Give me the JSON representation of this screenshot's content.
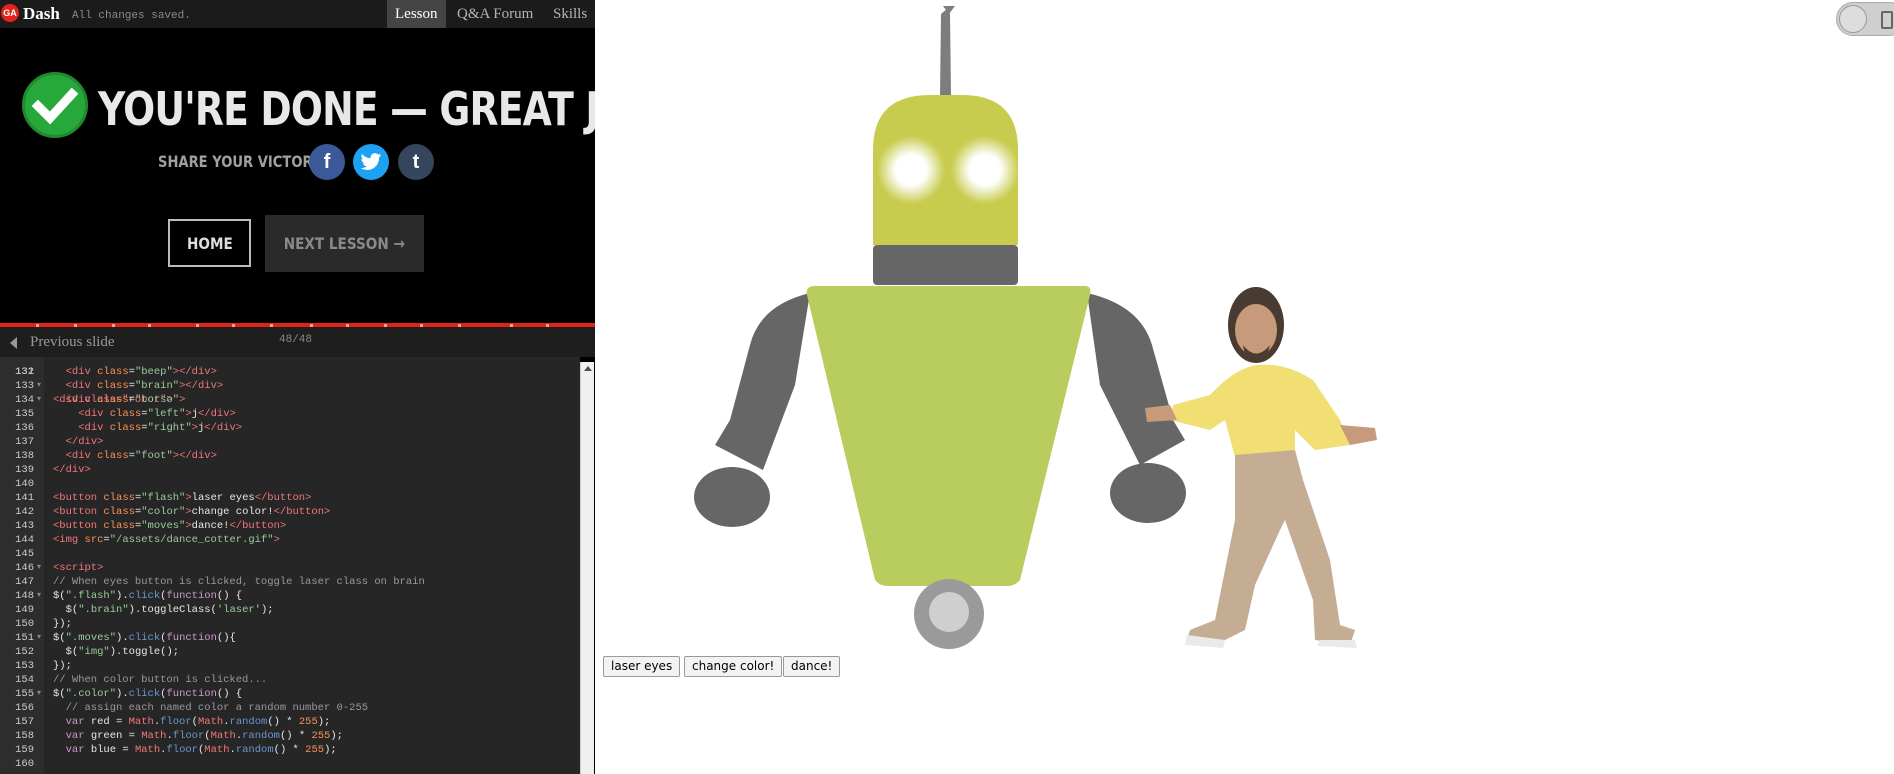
{
  "topbar": {
    "logo": "GA",
    "app_name": "Dash",
    "save_status": "All changes saved.",
    "tabs": [
      "Lesson",
      "Q&A Forum",
      "Skills"
    ]
  },
  "done": {
    "title": "YOU'RE DONE — GREAT JOB!",
    "share_label": "SHARE YOUR VICTORY:",
    "social": [
      "f",
      "t",
      "t"
    ],
    "home_label": "HOME",
    "next_label": "NEXT LESSON →"
  },
  "slides": {
    "prev_label": "Previous slide",
    "counter": "48/48"
  },
  "editor": {
    "first_line": "131",
    "first_line_text": "<div class=\"robot\">",
    "lines": [
      [
        "132",
        "",
        [
          [
            "t-def",
            "  "
          ],
          [
            "t-tag",
            "<div "
          ],
          [
            "t-attr",
            "class"
          ],
          [
            "t-def",
            "="
          ],
          [
            "t-str",
            "\"beep\""
          ],
          [
            "t-tag",
            "></div>"
          ]
        ]
      ],
      [
        "133",
        "",
        [
          [
            "t-def",
            "  "
          ],
          [
            "t-tag",
            "<div "
          ],
          [
            "t-attr",
            "class"
          ],
          [
            "t-def",
            "="
          ],
          [
            "t-str",
            "\"brain\""
          ],
          [
            "t-tag",
            "></div>"
          ]
        ]
      ],
      [
        "134",
        "▾",
        [
          [
            "t-def",
            "  "
          ],
          [
            "t-tag",
            "<div "
          ],
          [
            "t-attr",
            "class"
          ],
          [
            "t-def",
            "="
          ],
          [
            "t-str",
            "\"torso\""
          ],
          [
            "t-tag",
            ">"
          ]
        ]
      ],
      [
        "135",
        "",
        [
          [
            "t-def",
            "    "
          ],
          [
            "t-tag",
            "<div "
          ],
          [
            "t-attr",
            "class"
          ],
          [
            "t-def",
            "="
          ],
          [
            "t-str",
            "\"left\""
          ],
          [
            "t-tag",
            ">"
          ],
          [
            "t-def",
            "j"
          ],
          [
            "t-tag",
            "</div>"
          ]
        ]
      ],
      [
        "136",
        "",
        [
          [
            "t-def",
            "    "
          ],
          [
            "t-tag",
            "<div "
          ],
          [
            "t-attr",
            "class"
          ],
          [
            "t-def",
            "="
          ],
          [
            "t-str",
            "\"right\""
          ],
          [
            "t-tag",
            ">"
          ],
          [
            "t-def",
            "j"
          ],
          [
            "t-tag",
            "</div>"
          ]
        ]
      ],
      [
        "137",
        "",
        [
          [
            "t-def",
            "  "
          ],
          [
            "t-tag",
            "</div>"
          ]
        ]
      ],
      [
        "138",
        "",
        [
          [
            "t-def",
            "  "
          ],
          [
            "t-tag",
            "<div "
          ],
          [
            "t-attr",
            "class"
          ],
          [
            "t-def",
            "="
          ],
          [
            "t-str",
            "\"foot\""
          ],
          [
            "t-tag",
            "></div>"
          ]
        ]
      ],
      [
        "139",
        "",
        [
          [
            "t-tag",
            "</div>"
          ]
        ]
      ],
      [
        "140",
        "",
        []
      ],
      [
        "141",
        "",
        [
          [
            "t-tag",
            "<button "
          ],
          [
            "t-attr",
            "class"
          ],
          [
            "t-def",
            "="
          ],
          [
            "t-str",
            "\"flash\""
          ],
          [
            "t-tag",
            ">"
          ],
          [
            "t-def",
            "laser eyes"
          ],
          [
            "t-tag",
            "</button>"
          ]
        ]
      ],
      [
        "142",
        "",
        [
          [
            "t-tag",
            "<button "
          ],
          [
            "t-attr",
            "class"
          ],
          [
            "t-def",
            "="
          ],
          [
            "t-str",
            "\"color\""
          ],
          [
            "t-tag",
            ">"
          ],
          [
            "t-def",
            "change color!"
          ],
          [
            "t-tag",
            "</button>"
          ]
        ]
      ],
      [
        "143",
        "",
        [
          [
            "t-tag",
            "<button "
          ],
          [
            "t-attr",
            "class"
          ],
          [
            "t-def",
            "="
          ],
          [
            "t-str",
            "\"moves\""
          ],
          [
            "t-tag",
            ">"
          ],
          [
            "t-def",
            "dance!"
          ],
          [
            "t-tag",
            "</button>"
          ]
        ]
      ],
      [
        "144",
        "",
        [
          [
            "t-tag",
            "<img "
          ],
          [
            "t-attr",
            "src"
          ],
          [
            "t-def",
            "="
          ],
          [
            "t-str",
            "\"/assets/dance_cotter.gif\""
          ],
          [
            "t-tag",
            ">"
          ]
        ]
      ],
      [
        "145",
        "",
        []
      ],
      [
        "146",
        "▾",
        [
          [
            "t-tag",
            "<script>"
          ]
        ]
      ],
      [
        "147",
        "",
        [
          [
            "t-com",
            "// When eyes button is clicked, toggle laser class on brain"
          ]
        ]
      ],
      [
        "148",
        "▾",
        [
          [
            "t-def",
            "$("
          ],
          [
            "t-str",
            "\".flash\""
          ],
          [
            "t-def",
            ")."
          ],
          [
            "t-fn",
            "click"
          ],
          [
            "t-def",
            "("
          ],
          [
            "t-kw",
            "function"
          ],
          [
            "t-def",
            "() {"
          ]
        ]
      ],
      [
        "149",
        "",
        [
          [
            "t-def",
            "  $("
          ],
          [
            "t-str",
            "\".brain\""
          ],
          [
            "t-def",
            ").toggleClass("
          ],
          [
            "t-str",
            "'laser'"
          ],
          [
            "t-def",
            ");"
          ]
        ]
      ],
      [
        "150",
        "",
        [
          [
            "t-def",
            "});"
          ]
        ]
      ],
      [
        "151",
        "▾",
        [
          [
            "t-def",
            "$("
          ],
          [
            "t-str",
            "\".moves\""
          ],
          [
            "t-def",
            ")."
          ],
          [
            "t-fn",
            "click"
          ],
          [
            "t-def",
            "("
          ],
          [
            "t-kw",
            "function"
          ],
          [
            "t-def",
            "(){"
          ]
        ]
      ],
      [
        "152",
        "",
        [
          [
            "t-def",
            "  $("
          ],
          [
            "t-str",
            "\"img\""
          ],
          [
            "t-def",
            ").toggle();"
          ]
        ]
      ],
      [
        "153",
        "",
        [
          [
            "t-def",
            "});"
          ]
        ]
      ],
      [
        "154",
        "",
        [
          [
            "t-com",
            "// When color button is clicked..."
          ]
        ]
      ],
      [
        "155",
        "▾",
        [
          [
            "t-def",
            "$("
          ],
          [
            "t-str",
            "\".color\""
          ],
          [
            "t-def",
            ")."
          ],
          [
            "t-fn",
            "click"
          ],
          [
            "t-def",
            "("
          ],
          [
            "t-kw",
            "function"
          ],
          [
            "t-def",
            "() {"
          ]
        ]
      ],
      [
        "156",
        "",
        [
          [
            "t-com",
            "  // assign each named color a random number 0-255"
          ]
        ]
      ],
      [
        "157",
        "",
        [
          [
            "t-def",
            "  "
          ],
          [
            "t-kw",
            "var"
          ],
          [
            "t-def",
            " red = "
          ],
          [
            "t-tag",
            "Math"
          ],
          [
            "t-def",
            "."
          ],
          [
            "t-fn",
            "floor"
          ],
          [
            "t-def",
            "("
          ],
          [
            "t-tag",
            "Math"
          ],
          [
            "t-def",
            "."
          ],
          [
            "t-fn",
            "random"
          ],
          [
            "t-def",
            "() * "
          ],
          [
            "t-num",
            "255"
          ],
          [
            "t-def",
            ");"
          ]
        ]
      ],
      [
        "158",
        "",
        [
          [
            "t-def",
            "  "
          ],
          [
            "t-kw",
            "var"
          ],
          [
            "t-def",
            " green = "
          ],
          [
            "t-tag",
            "Math"
          ],
          [
            "t-def",
            "."
          ],
          [
            "t-fn",
            "floor"
          ],
          [
            "t-def",
            "("
          ],
          [
            "t-tag",
            "Math"
          ],
          [
            "t-def",
            "."
          ],
          [
            "t-fn",
            "random"
          ],
          [
            "t-def",
            "() * "
          ],
          [
            "t-num",
            "255"
          ],
          [
            "t-def",
            ");"
          ]
        ]
      ],
      [
        "159",
        "",
        [
          [
            "t-def",
            "  "
          ],
          [
            "t-kw",
            "var"
          ],
          [
            "t-def",
            " blue = "
          ],
          [
            "t-tag",
            "Math"
          ],
          [
            "t-def",
            "."
          ],
          [
            "t-fn",
            "floor"
          ],
          [
            "t-def",
            "("
          ],
          [
            "t-tag",
            "Math"
          ],
          [
            "t-def",
            "."
          ],
          [
            "t-fn",
            "random"
          ],
          [
            "t-def",
            "() * "
          ],
          [
            "t-num",
            "255"
          ],
          [
            "t-def",
            ");"
          ]
        ]
      ],
      [
        "160",
        "",
        []
      ]
    ]
  },
  "preview": {
    "buttons": [
      "laser eyes",
      "change color!",
      "dance!"
    ],
    "robot_head_color": "#c8cc4e",
    "robot_torso_color": "#b9cd5e",
    "robot_limb_color": "#666666"
  }
}
